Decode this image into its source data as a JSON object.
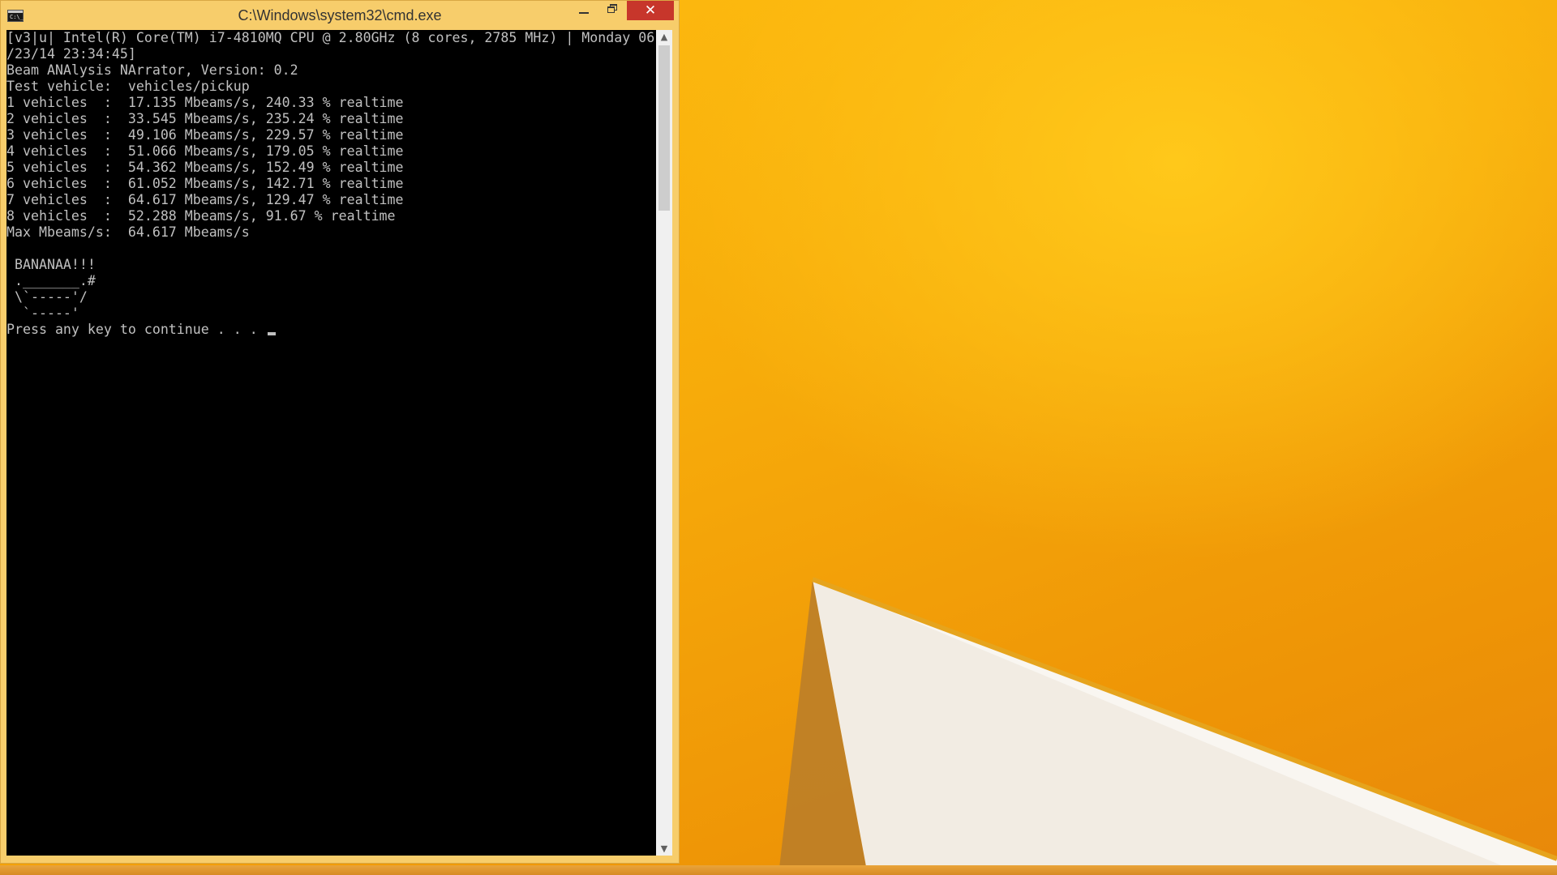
{
  "window": {
    "title": "C:\\Windows\\system32\\cmd.exe",
    "icon": "console-icon",
    "icon_text": "C:\\_",
    "controls": {
      "minimize": "minimize-icon",
      "maximize": "restore-icon",
      "close": "✕"
    }
  },
  "console": {
    "lines": [
      "[v3|u| Intel(R) Core(TM) i7-4810MQ CPU @ 2.80GHz (8 cores, 2785 MHz) | Monday 06",
      "/23/14 23:34:45]",
      "Beam ANAlysis NArrator, Version: 0.2",
      "Test vehicle:  vehicles/pickup",
      "1 vehicles  :  17.135 Mbeams/s, 240.33 % realtime",
      "2 vehicles  :  33.545 Mbeams/s, 235.24 % realtime",
      "3 vehicles  :  49.106 Mbeams/s, 229.57 % realtime",
      "4 vehicles  :  51.066 Mbeams/s, 179.05 % realtime",
      "5 vehicles  :  54.362 Mbeams/s, 152.49 % realtime",
      "6 vehicles  :  61.052 Mbeams/s, 142.71 % realtime",
      "7 vehicles  :  64.617 Mbeams/s, 129.47 % realtime",
      "8 vehicles  :  52.288 Mbeams/s, 91.67 % realtime",
      "Max Mbeams/s:  64.617 Mbeams/s",
      "",
      " BANANAA!!!",
      " ._______.#",
      " \\`-----'/",
      "  `-----'"
    ],
    "prompt": "Press any key to continue . . . ",
    "colors": {
      "background": "#000000",
      "foreground": "#c0c0c0"
    }
  },
  "scrollbar": {
    "up_arrow": "▲",
    "down_arrow": "▼"
  },
  "theme": {
    "frame": "#f7cd6b",
    "close_button": "#c7362b",
    "wallpaper": "#f7ab0a"
  }
}
